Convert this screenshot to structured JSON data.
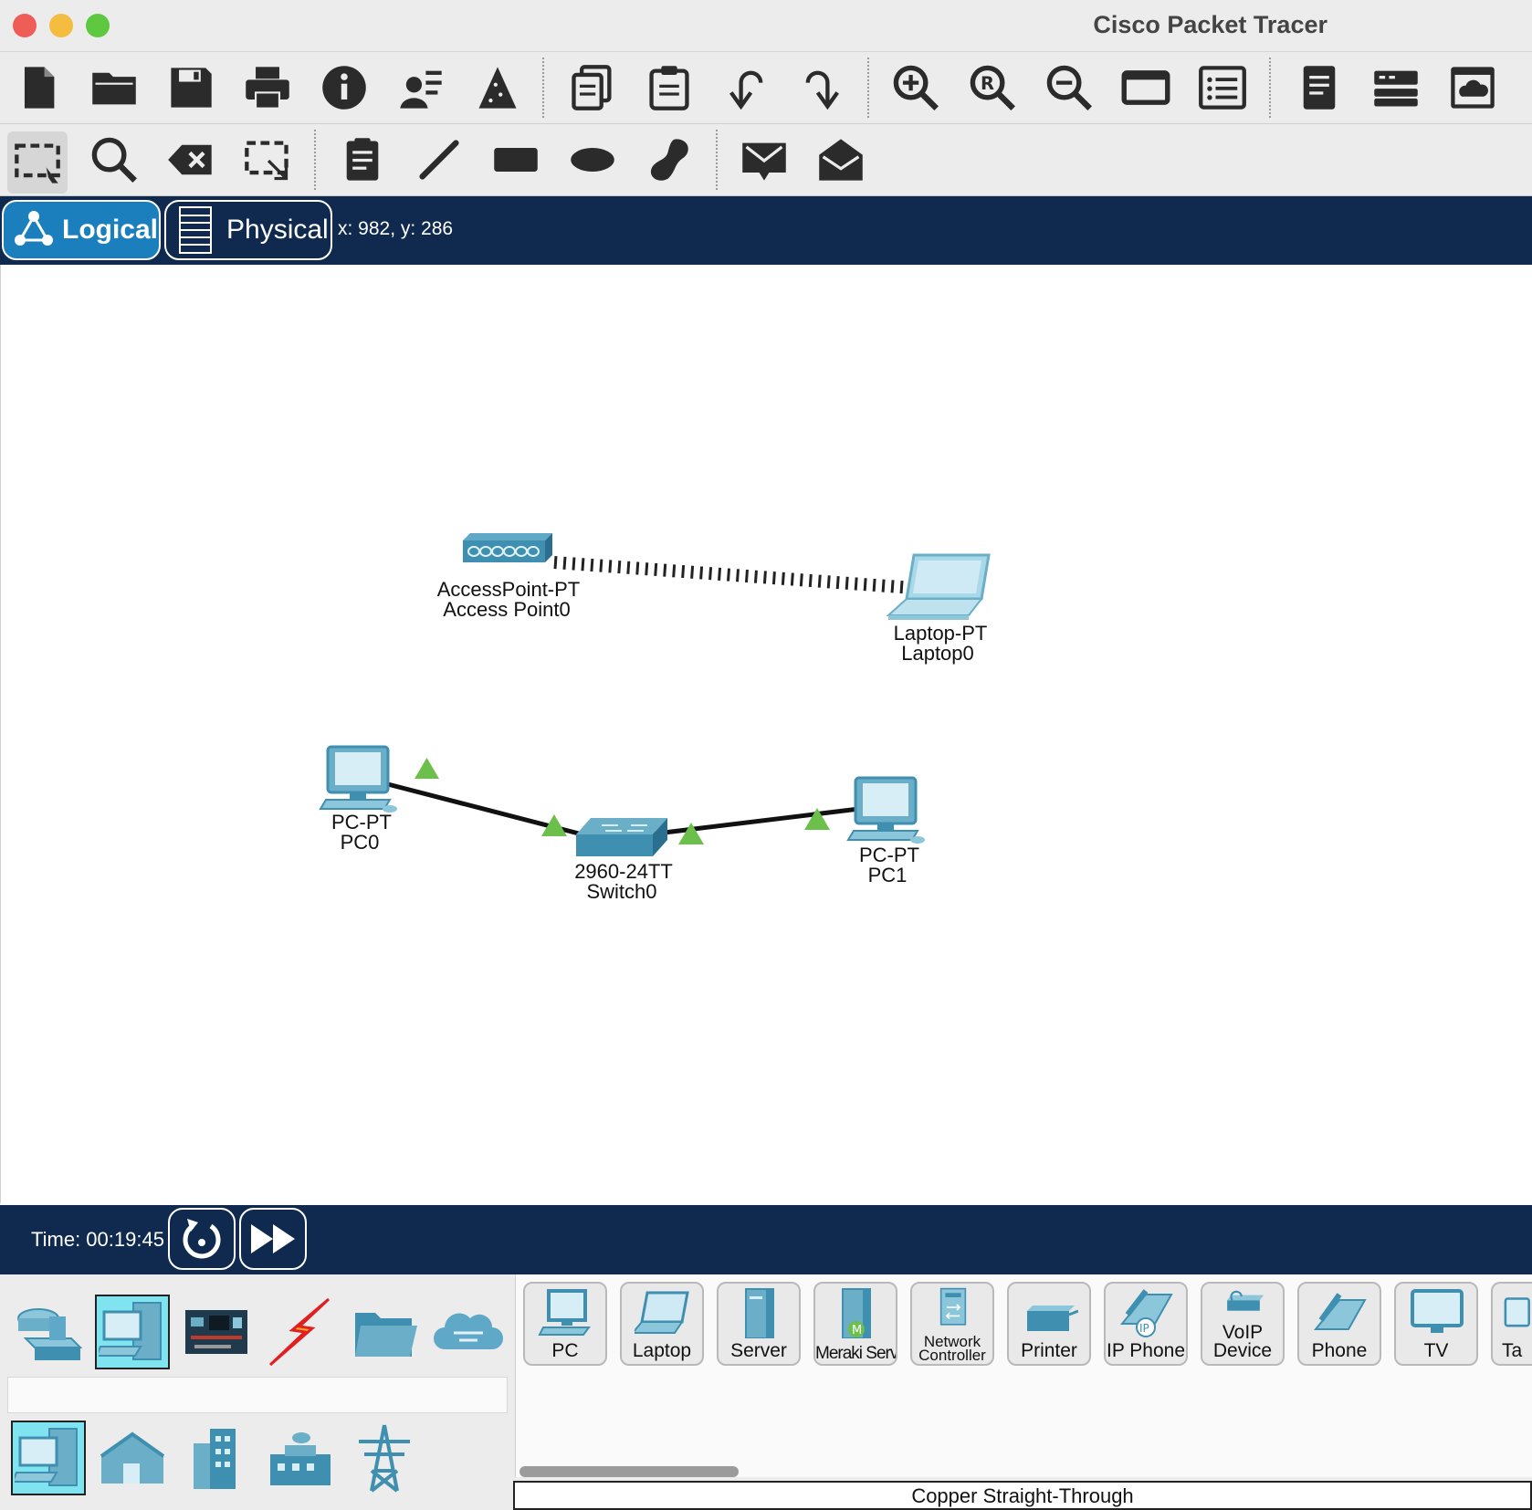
{
  "window": {
    "title": "Cisco Packet Tracer"
  },
  "toolbar_main": {
    "items": [
      "new-file-icon",
      "open-folder-icon",
      "save-icon",
      "print-icon",
      "info-icon",
      "activity-wizard-icon",
      "custom-device-icon",
      "copy-icon",
      "paste-icon",
      "undo-icon",
      "redo-icon",
      "zoom-in-icon",
      "zoom-reset-icon",
      "zoom-out-icon",
      "drawing-palette-icon",
      "custom-devices-dialog-icon",
      "viewport-icon",
      "network-info-icon",
      "cloud-icon"
    ]
  },
  "toolbar_tools": {
    "items": [
      "select-icon",
      "inspect-icon",
      "delete-icon",
      "resize-icon",
      "note-icon",
      "line-icon",
      "rectangle-icon",
      "ellipse-icon",
      "freeform-icon",
      "simple-pdu-icon",
      "complex-pdu-icon"
    ]
  },
  "modebar": {
    "logical_label": "Logical",
    "physical_label": "Physical",
    "coords": "x: 982, y: 286"
  },
  "workspace": {
    "devices": {
      "ap": {
        "model": "AccessPoint-PT",
        "name": "Access Point0"
      },
      "laptop": {
        "model": "Laptop-PT",
        "name": "Laptop0"
      },
      "pc0": {
        "model": "PC-PT",
        "name": "PC0"
      },
      "switch": {
        "model": "2960-24TT",
        "name": "Switch0"
      },
      "pc1": {
        "model": "PC-PT",
        "name": "PC1"
      }
    },
    "link_status_color": "#6cbf4b",
    "device_color": "#3f8fb0"
  },
  "timebar": {
    "time": "Time: 00:19:45"
  },
  "device_types": {
    "items": [
      {
        "label": "PC"
      },
      {
        "label": "Laptop"
      },
      {
        "label": "Server"
      },
      {
        "label": "Meraki Server"
      },
      {
        "label": "Network Controller"
      },
      {
        "label": "Printer"
      },
      {
        "label": "IP Phone"
      },
      {
        "label": "VoIP Device"
      },
      {
        "label": "Phone"
      },
      {
        "label": "TV"
      },
      {
        "label": "Ta"
      }
    ]
  },
  "status": {
    "cable": "Copper Straight-Through"
  }
}
